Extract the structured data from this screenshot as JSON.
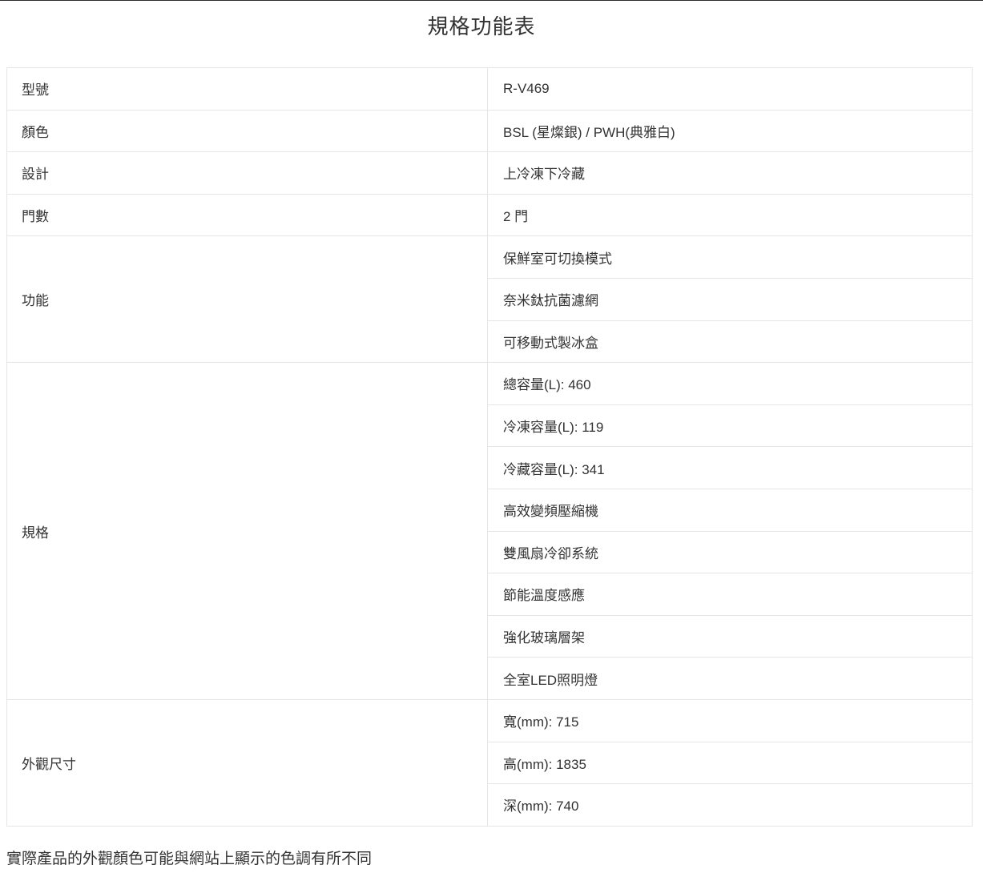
{
  "page": {
    "title": "規格功能表",
    "disclaimer": "實際產品的外觀顏色可能與網站上顯示的色調有所不同"
  },
  "spec_table": {
    "groups": [
      {
        "label": "型號",
        "values": [
          "R-V469"
        ]
      },
      {
        "label": "顏色",
        "values": [
          "BSL (星燦銀) / PWH(典雅白)"
        ]
      },
      {
        "label": "設計",
        "values": [
          "上冷凍下冷藏"
        ]
      },
      {
        "label": "門數",
        "values": [
          "2 門"
        ]
      },
      {
        "label": "功能",
        "values": [
          "保鮮室可切換模式",
          "奈米鈦抗菌濾網",
          "可移動式製冰盒"
        ]
      },
      {
        "label": "規格",
        "values": [
          "總容量(L): 460",
          "冷凍容量(L): 119",
          "冷藏容量(L): 341",
          "高效變頻壓縮機",
          "雙風扇冷卻系統",
          "節能溫度感應",
          "強化玻璃層架",
          "全室LED照明燈"
        ]
      },
      {
        "label": "外觀尺寸",
        "values": [
          "寬(mm): 715",
          "高(mm): 1835",
          "深(mm): 740"
        ]
      }
    ]
  }
}
